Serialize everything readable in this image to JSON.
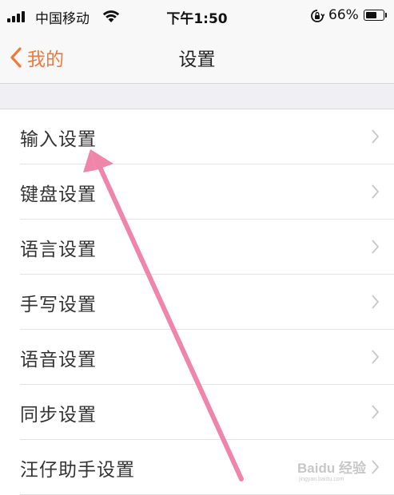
{
  "status_bar": {
    "carrier": "中国移动",
    "time": "下午1:50",
    "battery_percent": "66%",
    "battery_level": 0.66
  },
  "nav": {
    "back_label": "我的",
    "title": "设置",
    "accent_color": "#ee7a3b"
  },
  "settings": {
    "items": [
      {
        "label": "输入设置"
      },
      {
        "label": "键盘设置"
      },
      {
        "label": "语言设置"
      },
      {
        "label": "手写设置"
      },
      {
        "label": "语音设置"
      },
      {
        "label": "同步设置"
      },
      {
        "label": "汪仔助手设置"
      }
    ]
  },
  "annotation": {
    "icon": "pink-arrow-icon",
    "color": "#ef86a9",
    "points_to": "输入设置"
  },
  "watermark": {
    "text": "Baidu 经验",
    "subtext": "jingyan.baidu.com"
  }
}
